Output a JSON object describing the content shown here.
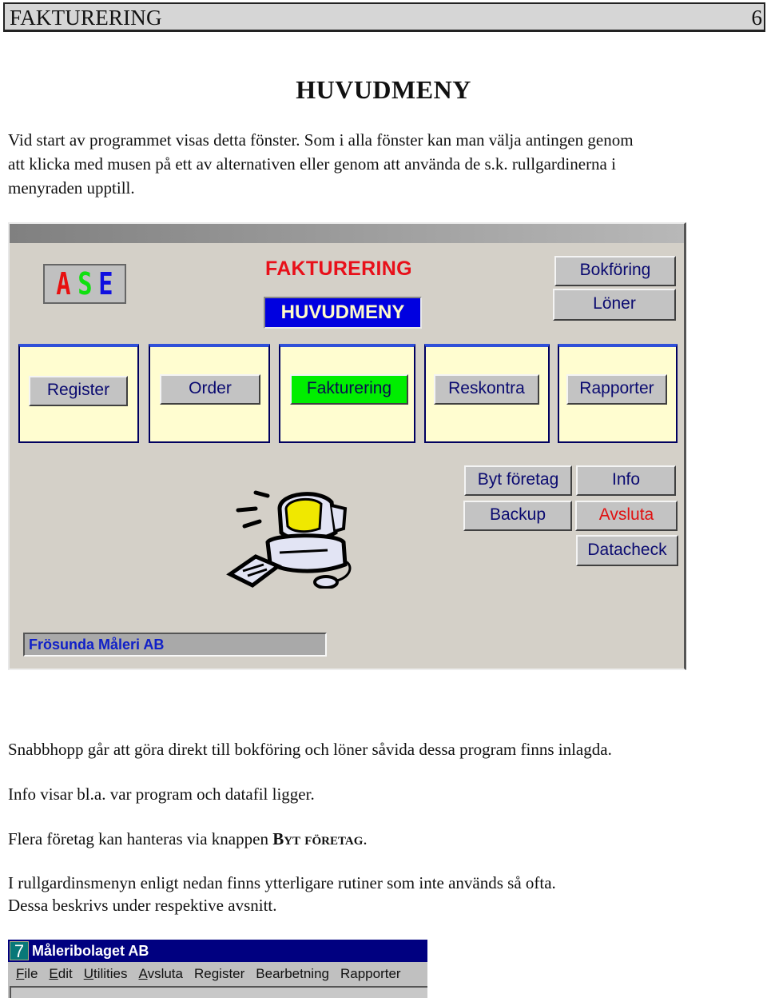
{
  "page_header": {
    "title": "FAKTURERING",
    "page_number": "6"
  },
  "heading": "HUVUDMENY",
  "intro_paragraph": {
    "line1": "Vid start av programmet visas detta fönster. Som i alla fönster kan man välja antingen genom",
    "line2": "att klicka med musen på ett av alternativen eller genom att använda de s.k. rullgardinerna i",
    "line3": "menyraden upptill."
  },
  "app_window": {
    "logo_letters": [
      {
        "char": "A",
        "color": "#e81010"
      },
      {
        "char": "S",
        "color": "#10e010"
      },
      {
        "char": "E",
        "color": "#1010e0"
      }
    ],
    "title": "FAKTURERING",
    "subtitle": "HUVUDMENY",
    "quick_jump_buttons": {
      "bokforing": "Bokföring",
      "loner": "Löner"
    },
    "module_buttons": [
      {
        "label": "Register",
        "active": false
      },
      {
        "label": "Order",
        "active": false
      },
      {
        "label": "Fakturering",
        "active": true
      },
      {
        "label": "Reskontra",
        "active": false
      },
      {
        "label": "Rapporter",
        "active": false
      }
    ],
    "utility_buttons": {
      "byt_foretag": "Byt företag",
      "info": "Info",
      "backup": "Backup",
      "avsluta": "Avsluta",
      "datacheck": "Datacheck"
    },
    "company_name": "Frösunda Måleri AB",
    "clipart": "computer-clipart",
    "colors": {
      "title_red": "#e8101a",
      "subtitle_bg": "#0000e0",
      "active_module": "#00ee00",
      "panel_bg": "#fffdd0",
      "button_text": "#0a0a70"
    }
  },
  "paragraphs": {
    "snabbhopp": "Snabbhopp går att göra direkt till bokföring och löner såvida dessa program finns inlagda.",
    "info": "Info visar bl.a. var program och datafil ligger.",
    "flera_prefix": "Flera företag kan hanteras via knappen ",
    "flera_button": "Byt företag",
    "flera_suffix": ".",
    "rullgardin_line1": "I rullgardinsmenyn enligt nedan finns ytterligare rutiner som inte används så ofta.",
    "rullgardin_line2": "Dessa beskrivs under respektive avsnitt."
  },
  "menu_window": {
    "icon_text": "7",
    "title": "Måleribolaget AB",
    "menu_items": [
      {
        "label": "File",
        "mnemonic": "F",
        "rest": "ile"
      },
      {
        "label": "Edit",
        "mnemonic": "E",
        "rest": "dit"
      },
      {
        "label": "Utilities",
        "mnemonic": "U",
        "rest": "tilities"
      },
      {
        "label": "Avsluta",
        "mnemonic": "A",
        "rest": "vsluta"
      },
      {
        "label": "Register",
        "mnemonic": "",
        "rest": "Register"
      },
      {
        "label": "Bearbetning",
        "mnemonic": "",
        "rest": "Bearbetning"
      },
      {
        "label": "Rapporter",
        "mnemonic": "",
        "rest": "Rapporter"
      }
    ]
  }
}
